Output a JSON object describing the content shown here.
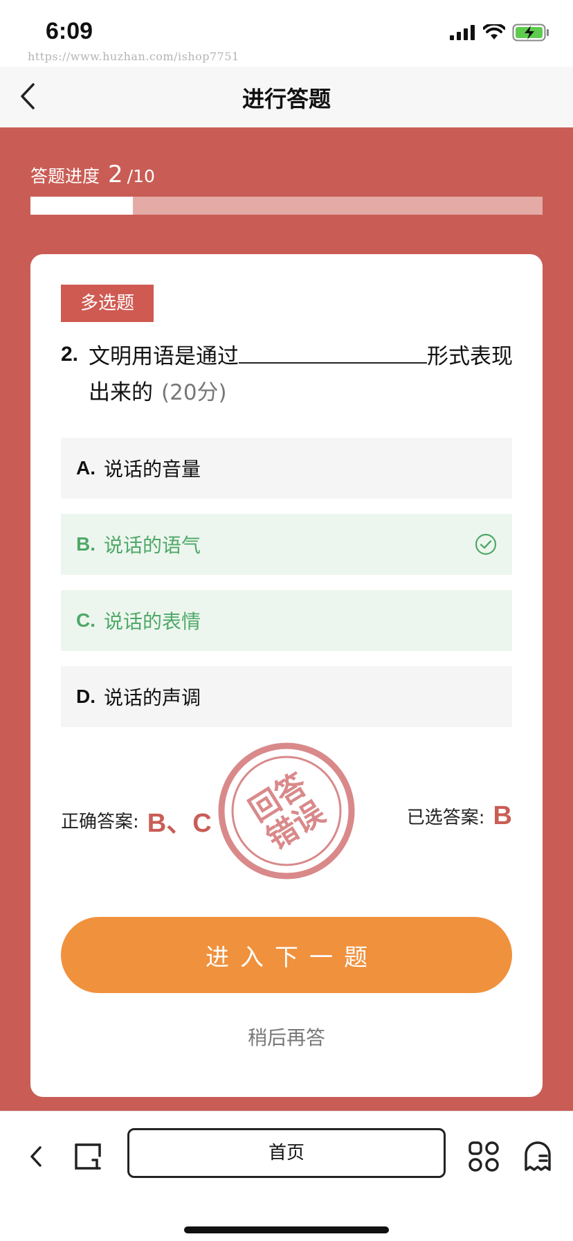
{
  "status": {
    "time": "6:09",
    "watermark": "https://www.huzhan.com/ishop7751"
  },
  "nav": {
    "title": "进行答题",
    "back_icon": "chevron-left-icon"
  },
  "progress": {
    "label": "答题进度",
    "current": "2",
    "total": "/10",
    "fraction": 0.2
  },
  "question": {
    "type": "多选题",
    "number": "2.",
    "text_before": "文明用语是通过",
    "text_after": "形式表现出来的",
    "score": "(20分)"
  },
  "options": [
    {
      "letter": "A.",
      "text": "说话的音量",
      "state": "normal"
    },
    {
      "letter": "B.",
      "text": "说话的语气",
      "state": "selected"
    },
    {
      "letter": "C.",
      "text": "说话的表情",
      "state": "correct"
    },
    {
      "letter": "D.",
      "text": "说话的声调",
      "state": "normal"
    }
  ],
  "answers": {
    "correct_label": "正确答案:",
    "correct_value": "B、C",
    "selected_label": "已选答案:",
    "selected_value": "B"
  },
  "stamp": {
    "line1": "回答",
    "line2": "错误"
  },
  "actions": {
    "next": "进入下一题",
    "later": "稍后再答"
  },
  "toolbar": {
    "home": "首页"
  },
  "colors": {
    "primary_red": "#c95d55",
    "progress_track": "#e3aaa6",
    "success_green": "#4fa869",
    "accent_orange": "#f0913d"
  }
}
